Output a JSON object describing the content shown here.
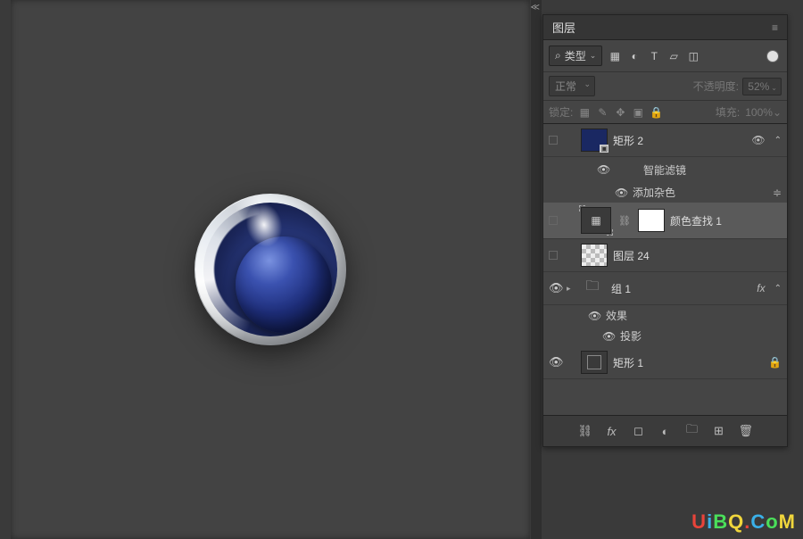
{
  "panel": {
    "title": "图层"
  },
  "filter": {
    "label": "类型",
    "search_icon": "⌕"
  },
  "blend": {
    "mode": "正常",
    "opacity_label": "不透明度:",
    "opacity_value": "52%"
  },
  "lock": {
    "label": "锁定:",
    "fill_label": "填充:",
    "fill_value": "100%"
  },
  "layers": {
    "l0": {
      "name": "矩形 2"
    },
    "l0_sf": {
      "name": "智能滤镜"
    },
    "l0_noise": {
      "name": "添加杂色"
    },
    "l1": {
      "name": "颜色查找 1"
    },
    "l2": {
      "name": "图层 24"
    },
    "l3": {
      "name": "组 1",
      "fx": "fx"
    },
    "l3_fx": {
      "name": "效果"
    },
    "l3_ds": {
      "name": "投影"
    },
    "l4": {
      "name": "矩形 1"
    }
  },
  "watermark": {
    "u": "U",
    "i": "i",
    "b": "B",
    "q": "Q",
    "dot": ".",
    "c": "C",
    "o": "o",
    "m": "M"
  }
}
